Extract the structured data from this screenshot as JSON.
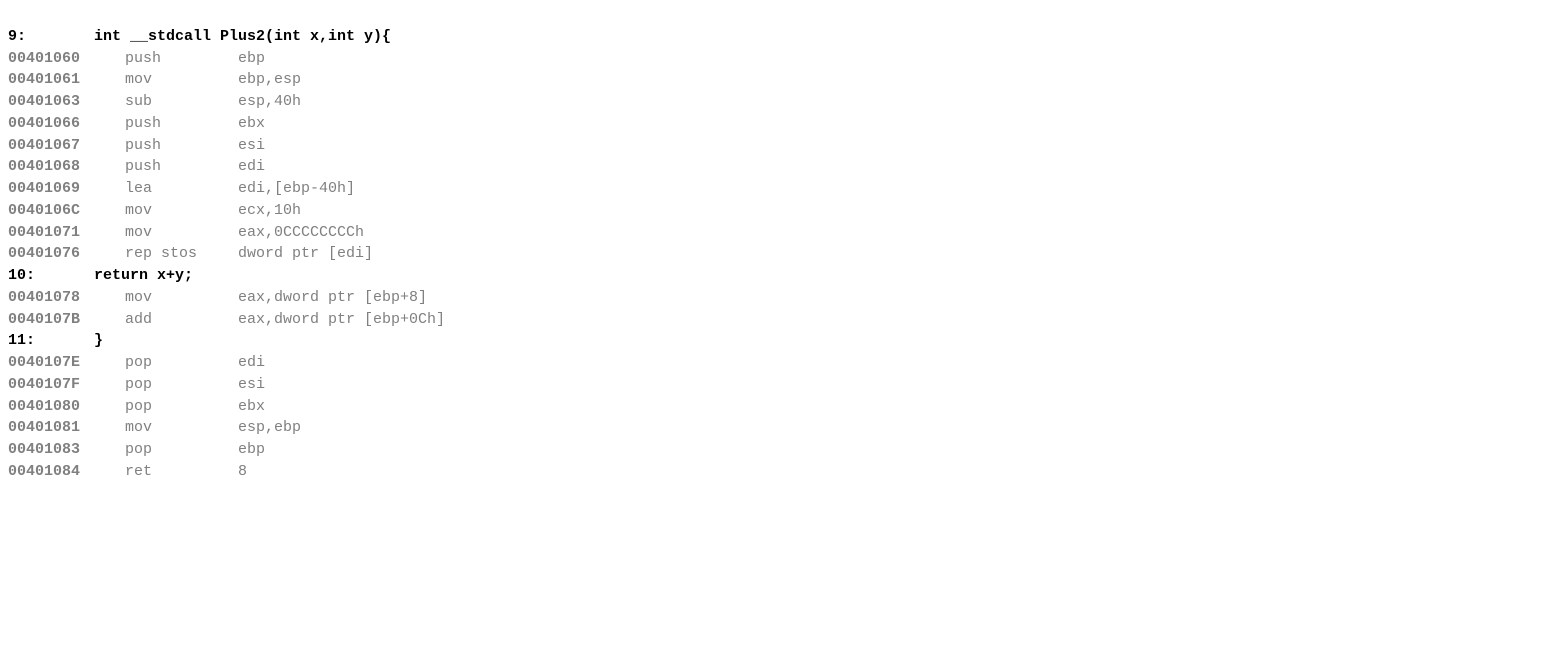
{
  "disasm": {
    "lines": [
      {
        "type": "source",
        "linenum": "9:",
        "content": "    int __stdcall Plus2(int x,int y){"
      },
      {
        "type": "asm",
        "addr": "00401060",
        "mnemonic": "push",
        "operand": "ebp"
      },
      {
        "type": "asm",
        "addr": "00401061",
        "mnemonic": "mov",
        "operand": "ebp,esp"
      },
      {
        "type": "asm",
        "addr": "00401063",
        "mnemonic": "sub",
        "operand": "esp,40h"
      },
      {
        "type": "asm",
        "addr": "00401066",
        "mnemonic": "push",
        "operand": "ebx"
      },
      {
        "type": "asm",
        "addr": "00401067",
        "mnemonic": "push",
        "operand": "esi"
      },
      {
        "type": "asm",
        "addr": "00401068",
        "mnemonic": "push",
        "operand": "edi"
      },
      {
        "type": "asm",
        "addr": "00401069",
        "mnemonic": "lea",
        "operand": "edi,[ebp-40h]"
      },
      {
        "type": "asm",
        "addr": "0040106C",
        "mnemonic": "mov",
        "operand": "ecx,10h"
      },
      {
        "type": "asm",
        "addr": "00401071",
        "mnemonic": "mov",
        "operand": "eax,0CCCCCCCCh"
      },
      {
        "type": "asm",
        "addr": "00401076",
        "mnemonic": "rep stos",
        "operand": "dword ptr [edi]"
      },
      {
        "type": "source",
        "linenum": "10:",
        "content": "    return x+y;"
      },
      {
        "type": "asm",
        "addr": "00401078",
        "mnemonic": "mov",
        "operand": "eax,dword ptr [ebp+8]"
      },
      {
        "type": "asm",
        "addr": "0040107B",
        "mnemonic": "add",
        "operand": "eax,dword ptr [ebp+0Ch]"
      },
      {
        "type": "source",
        "linenum": "11:",
        "content": "    }"
      },
      {
        "type": "asm",
        "addr": "0040107E",
        "mnemonic": "pop",
        "operand": "edi"
      },
      {
        "type": "asm",
        "addr": "0040107F",
        "mnemonic": "pop",
        "operand": "esi"
      },
      {
        "type": "asm",
        "addr": "00401080",
        "mnemonic": "pop",
        "operand": "ebx"
      },
      {
        "type": "asm",
        "addr": "00401081",
        "mnemonic": "mov",
        "operand": "esp,ebp"
      },
      {
        "type": "asm",
        "addr": "00401083",
        "mnemonic": "pop",
        "operand": "ebp"
      },
      {
        "type": "asm",
        "addr": "00401084",
        "mnemonic": "ret",
        "operand": "8"
      }
    ]
  }
}
